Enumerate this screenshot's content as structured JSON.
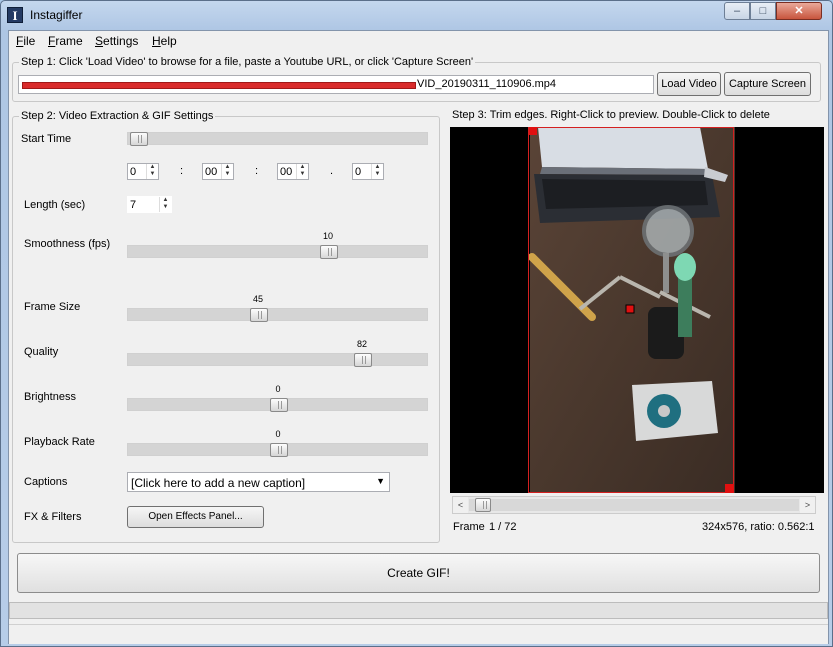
{
  "window": {
    "title": "Instagiffer",
    "app_icon_letter": "I",
    "minimize": "–",
    "maximize": "□",
    "close": "✕"
  },
  "menu": [
    {
      "label": "File",
      "accel": "F",
      "rest": "ile"
    },
    {
      "label": "Frame",
      "accel": "F",
      "rest": "rame"
    },
    {
      "label": "Settings",
      "accel": "S",
      "rest": "ettings"
    },
    {
      "label": "Help",
      "accel": "H",
      "rest": "elp"
    }
  ],
  "step1": {
    "title": "Step 1: Click 'Load Video' to browse for a file, paste a Youtube URL, or click 'Capture Screen'",
    "path_visible": "VID_20190311_110906.mp4",
    "load_video": "Load Video",
    "capture_screen": "Capture Screen"
  },
  "step2": {
    "title": "Step 2: Video Extraction & GIF Settings",
    "start_time_label": "Start Time",
    "start_time_position": 0.03,
    "time_fields": [
      "0",
      "00",
      "00",
      "0"
    ],
    "time_separators": [
      ":",
      ":",
      "."
    ],
    "length_label": "Length (sec)",
    "length_value": "7",
    "smoothness_label": "Smoothness (fps)",
    "smoothness_value": "10",
    "smoothness_position": 0.68,
    "frame_size_label": "Frame Size",
    "frame_size_value": "45",
    "frame_size_position": 0.43,
    "quality_label": "Quality",
    "quality_value": "82",
    "quality_position": 0.8,
    "brightness_label": "Brightness",
    "brightness_value": "0",
    "brightness_position": 0.5,
    "playback_label": "Playback Rate",
    "playback_value": "0",
    "playback_position": 0.5,
    "captions_label": "Captions",
    "captions_value": "[Click here to add a new caption]",
    "fx_label": "FX & Filters",
    "fx_button": "Open Effects Panel..."
  },
  "step3": {
    "title": "Step 3: Trim edges. Right-Click to preview. Double-Click to delete",
    "frame_label": "Frame",
    "frame_value": "1 / 72",
    "dimensions": "324x576, ratio: 0.562:1",
    "scroll_left": "<",
    "scroll_right": ">",
    "scroll_position": 0.02
  },
  "create_button": "Create GIF!",
  "colors": {
    "trim_border": "#d42020",
    "trim_handle": "#e01010",
    "preview_bg": "#000000"
  }
}
